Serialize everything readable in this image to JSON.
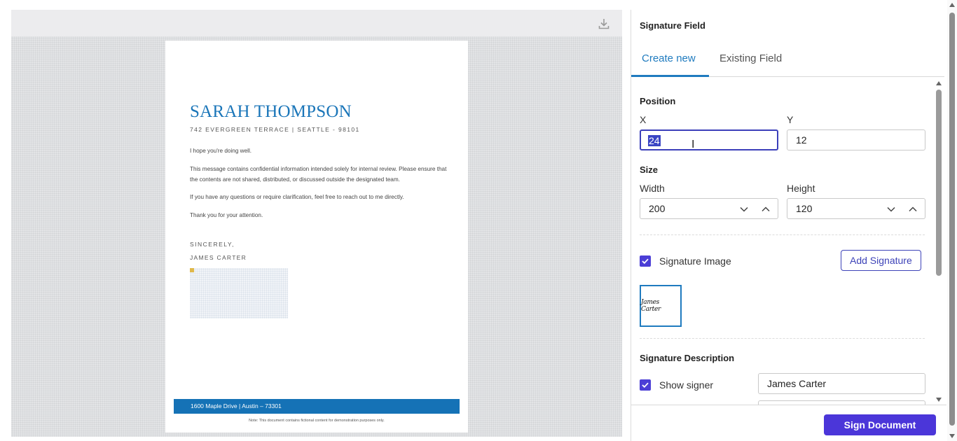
{
  "colors": {
    "accent": "#1f7bbf",
    "primary_button": "#4b36d9",
    "checkbox": "#4b3ed6",
    "doc_blue": "#1572b6"
  },
  "document": {
    "name": "SARAH THOMPSON",
    "address": "742 EVERGREEN TERRACE | SEATTLE - 98101",
    "paragraphs": [
      "I hope you're doing well.",
      "This message contains confidential information intended solely for internal review. Please ensure that the contents are not shared, distributed, or discussed outside the designated team.",
      "If you have any questions or require clarification, feel free to reach out to me directly.",
      "Thank you for your attention."
    ],
    "closing": "SINCERELY,",
    "signer": "JAMES CARTER",
    "footer_address": "1600 Maple Drive | Austin – 73301",
    "footer_note": "Note: This document contains fictional content for demonstration purposes only."
  },
  "viewer": {
    "download_icon": "download-icon"
  },
  "panel": {
    "title": "Signature Field",
    "tabs": [
      {
        "label": "Create new",
        "active": true
      },
      {
        "label": "Existing Field",
        "active": false
      }
    ],
    "position": {
      "heading": "Position",
      "x_label": "X",
      "x_value": "24",
      "y_label": "Y",
      "y_value": "12"
    },
    "size": {
      "heading": "Size",
      "width_label": "Width",
      "width_value": "200",
      "height_label": "Height",
      "height_value": "120"
    },
    "signature_image": {
      "label": "Signature Image",
      "checked": true,
      "add_button": "Add Signature",
      "thumbnail_text": "James Carter"
    },
    "description": {
      "heading": "Signature Description",
      "show_signer_label": "Show signer",
      "show_signer_checked": true,
      "signer_value": "James Carter"
    },
    "sign_button": "Sign Document"
  }
}
